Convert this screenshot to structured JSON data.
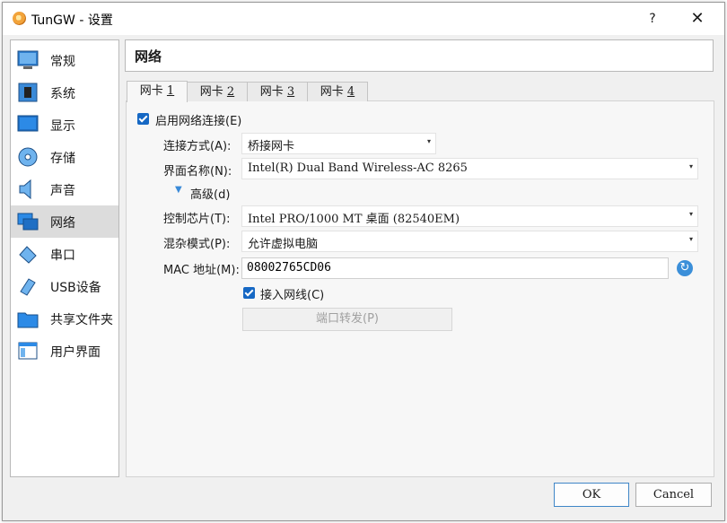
{
  "window": {
    "title": "TunGW - 设置",
    "help_label": "?",
    "close_label": "✕"
  },
  "sidebar": {
    "items": [
      {
        "label": "常规",
        "icon": "general-icon"
      },
      {
        "label": "系统",
        "icon": "system-icon"
      },
      {
        "label": "显示",
        "icon": "display-icon"
      },
      {
        "label": "存储",
        "icon": "storage-icon"
      },
      {
        "label": "声音",
        "icon": "audio-icon"
      },
      {
        "label": "网络",
        "icon": "network-icon",
        "selected": true
      },
      {
        "label": "串口",
        "icon": "serial-port-icon"
      },
      {
        "label": "USB设备",
        "icon": "usb-icon"
      },
      {
        "label": "共享文件夹",
        "icon": "shared-folder-icon"
      },
      {
        "label": "用户界面",
        "icon": "user-interface-icon"
      }
    ]
  },
  "page": {
    "title": "网络"
  },
  "tabs": [
    {
      "prefix": "网卡 ",
      "key": "1"
    },
    {
      "prefix": "网卡 ",
      "key": "2"
    },
    {
      "prefix": "网卡 ",
      "key": "3"
    },
    {
      "prefix": "网卡 ",
      "key": "4"
    }
  ],
  "adapter": {
    "enable_label": "启用网络连接(E)",
    "attached_label": "连接方式(A):",
    "attached_value": "桥接网卡",
    "name_label": "界面名称(N):",
    "name_value": "Intel(R) Dual Band Wireless-AC 8265",
    "advanced_label": "高级(d)",
    "type_label": "控制芯片(T):",
    "type_value": "Intel PRO/1000 MT 桌面 (82540EM)",
    "promisc_label": "混杂模式(P):",
    "promisc_value": "允许虚拟电脑",
    "mac_label": "MAC 地址(M):",
    "mac_value": "08002765CD06",
    "cable_label": "接入网线(C)",
    "portfwd_label": "端口转发(P)"
  },
  "buttons": {
    "ok": "OK",
    "cancel": "Cancel"
  },
  "colors": {
    "accent": "#1668c4",
    "selected_bg": "#dcdcdc"
  }
}
